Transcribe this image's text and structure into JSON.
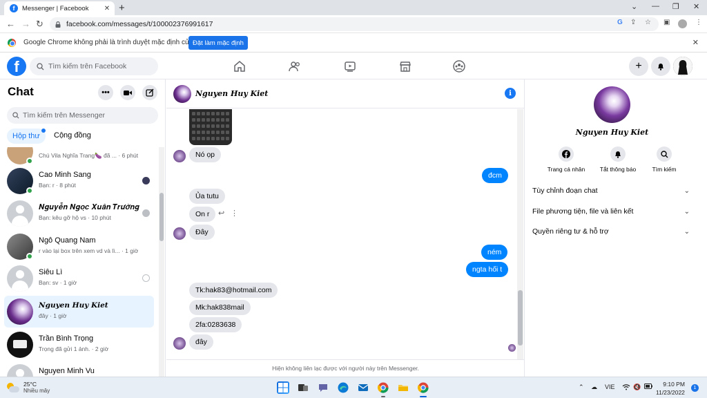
{
  "browser": {
    "tab_title": "Messenger | Facebook",
    "url": "facebook.com/messages/t/100002376991617",
    "infobar_message": "Google Chrome không phải là trình duyệt mặc định của bạn",
    "infobar_button": "Đặt làm mặc định"
  },
  "fb": {
    "logo": "f",
    "search_placeholder": "Tìm kiếm trên Facebook",
    "nav_icons": [
      "home-icon",
      "friends-icon",
      "watch-icon",
      "marketplace-icon",
      "groups-icon"
    ],
    "accent": "#1877f2"
  },
  "chat_panel": {
    "title": "Chat",
    "search_placeholder": "Tìm kiếm trên Messenger",
    "tabs": [
      "Hộp thư",
      "Cộng đồng"
    ],
    "conversations": [
      {
        "name": "",
        "preview": "Chú Vila Nghĩa Trang🍆 đã ... · 6 phút",
        "online": true
      },
      {
        "name": "Cao Minh Sang",
        "preview": "Bạn: r · 8 phút",
        "online": true
      },
      {
        "name": "𝑵𝒈𝒖𝒚𝒆̂̃𝒏 𝑵𝒈𝒐̣𝒄 𝑿𝒖𝒂̂𝒏 𝑻𝒓𝒖̛𝒐̛̀𝒏𝒈",
        "preview": "Bạn: kêu gỡ hộ vs · 10 phút",
        "online": false
      },
      {
        "name": "Ngô Quang Nam",
        "preview": "r vào lại box trên xem vd và lì... · 1 giờ",
        "online": true
      },
      {
        "name": "Siêu Lì",
        "preview": "Bạn: sv · 1 giờ",
        "online": false
      },
      {
        "name": "Nguyen Huy Kiet",
        "preview": "đây · 1 giờ",
        "online": false
      },
      {
        "name": "Trần Bình Trọng",
        "preview": "Trọng đã gửi 1 ảnh. · 2 giờ",
        "online": false
      },
      {
        "name": "Nguyen Minh Vu",
        "preview": "",
        "online": false
      }
    ]
  },
  "conversation": {
    "contact_name": "Nguyen Huy Kiet",
    "messages": [
      {
        "from": "them",
        "text": "Nó ọp"
      },
      {
        "from": "me",
        "text": "đcm"
      },
      {
        "from": "them",
        "text": "Ủa tutu"
      },
      {
        "from": "them",
        "text": "On r"
      },
      {
        "from": "them",
        "text": "Đây"
      },
      {
        "from": "me",
        "text": "ném"
      },
      {
        "from": "me",
        "text": "ngta hối t"
      },
      {
        "from": "them",
        "text": "Tk:hak83@hotmail.com"
      },
      {
        "from": "them",
        "text": "Mk:hak838mail"
      },
      {
        "from": "them",
        "text": "2fa:0283638"
      },
      {
        "from": "them",
        "text": "đây"
      }
    ],
    "footer_note": "Hiện không liên lạc được với người này trên Messenger.",
    "outgoing_color": "#0084ff",
    "incoming_color": "#e4e6eb"
  },
  "right_panel": {
    "name": "Nguyen Huy Kiet",
    "actions": [
      {
        "icon": "facebook-icon",
        "label": "Trang cá nhân"
      },
      {
        "icon": "bell-icon",
        "label": "Tắt thông báo"
      },
      {
        "icon": "search-icon",
        "label": "Tìm kiếm"
      }
    ],
    "sections": [
      "Tùy chỉnh đoạn chat",
      "File phương tiện, file và liên kết",
      "Quyền riêng tư & hỗ trợ"
    ]
  },
  "taskbar": {
    "temperature": "25°C",
    "weather": "Nhiều mây",
    "language": "VIE",
    "time": "9:10 PM",
    "date": "11/23/2022",
    "notifications": "1"
  }
}
